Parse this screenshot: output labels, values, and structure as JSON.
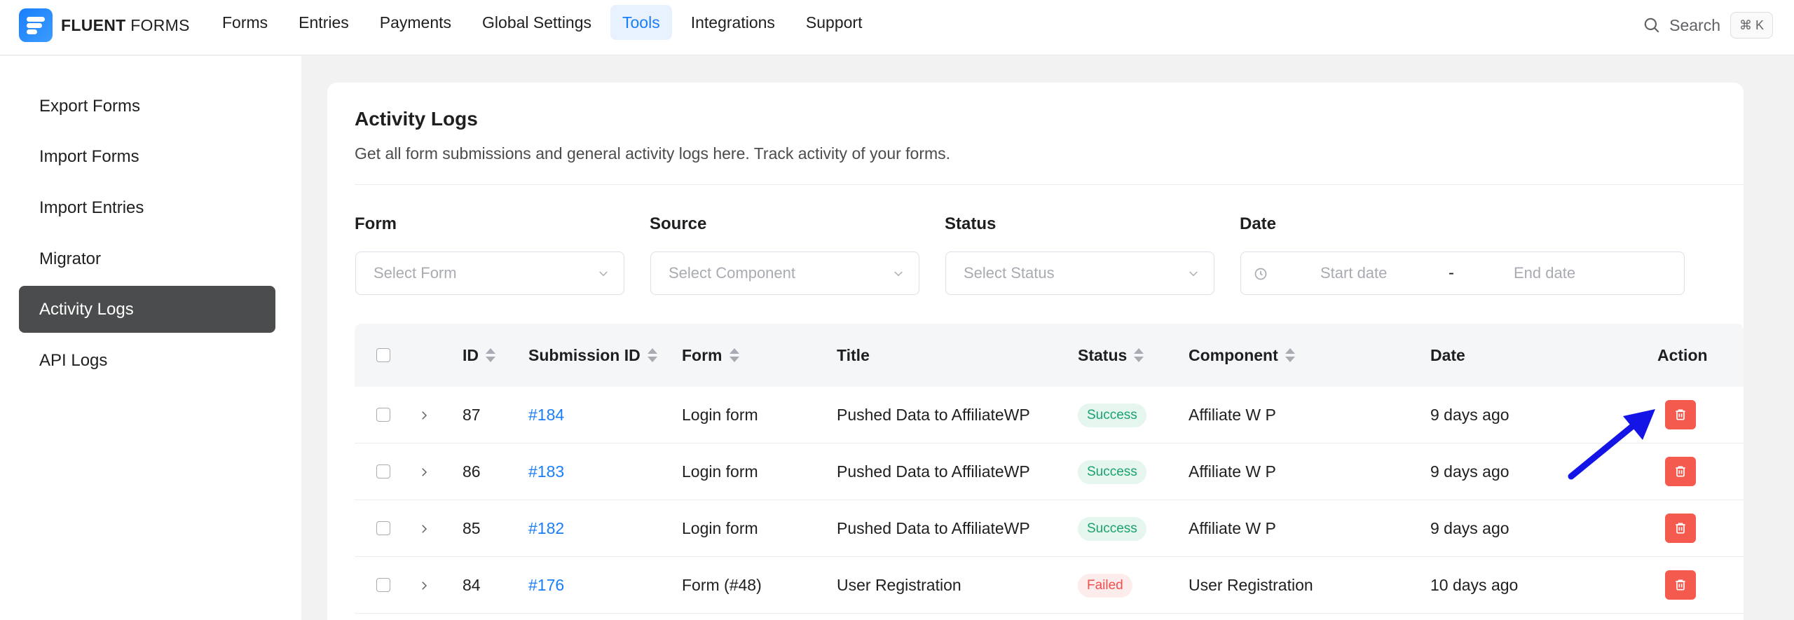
{
  "brand": {
    "name_bold": "FLUENT",
    "name_light": " FORMS"
  },
  "nav": {
    "items": [
      {
        "label": "Forms"
      },
      {
        "label": "Entries"
      },
      {
        "label": "Payments"
      },
      {
        "label": "Global Settings"
      },
      {
        "label": "Tools",
        "active": true
      },
      {
        "label": "Integrations"
      },
      {
        "label": "Support"
      }
    ]
  },
  "search": {
    "label": "Search",
    "shortcut": "⌘ K"
  },
  "sidebar": {
    "items": [
      {
        "label": "Export Forms"
      },
      {
        "label": "Import Forms"
      },
      {
        "label": "Import Entries"
      },
      {
        "label": "Migrator"
      },
      {
        "label": "Activity Logs",
        "active": true
      },
      {
        "label": "API Logs"
      }
    ]
  },
  "main": {
    "title": "Activity Logs",
    "description": "Get all form submissions and general activity logs here. Track activity of your forms.",
    "filters": {
      "form": {
        "label": "Form",
        "placeholder": "Select Form"
      },
      "source": {
        "label": "Source",
        "placeholder": "Select Component"
      },
      "status": {
        "label": "Status",
        "placeholder": "Select Status"
      },
      "date": {
        "label": "Date",
        "start_placeholder": "Start date",
        "separator": "-",
        "end_placeholder": "End date"
      }
    },
    "table": {
      "headers": {
        "id": "ID",
        "submission_id": "Submission ID",
        "form": "Form",
        "title": "Title",
        "status": "Status",
        "component": "Component",
        "date": "Date",
        "action": "Action"
      },
      "rows": [
        {
          "id": "87",
          "submission_id": "#184",
          "form": "Login form",
          "title": "Pushed Data to AffiliateWP",
          "status": "Success",
          "component": "Affiliate W P",
          "date": "9 days ago"
        },
        {
          "id": "86",
          "submission_id": "#183",
          "form": "Login form",
          "title": "Pushed Data to AffiliateWP",
          "status": "Success",
          "component": "Affiliate W P",
          "date": "9 days ago"
        },
        {
          "id": "85",
          "submission_id": "#182",
          "form": "Login form",
          "title": "Pushed Data to AffiliateWP",
          "status": "Success",
          "component": "Affiliate W P",
          "date": "9 days ago"
        },
        {
          "id": "84",
          "submission_id": "#176",
          "form": "Form (#48)",
          "title": "User Registration",
          "status": "Failed",
          "component": "User Registration",
          "date": "10 days ago"
        }
      ]
    }
  },
  "colors": {
    "accent": "#1a7efb",
    "sidebar_active": "#4b4c4d",
    "delete": "#f55a4e",
    "success": "#1aa36d",
    "failed": "#f04f4f",
    "annotation_arrow": "#1414e6"
  }
}
